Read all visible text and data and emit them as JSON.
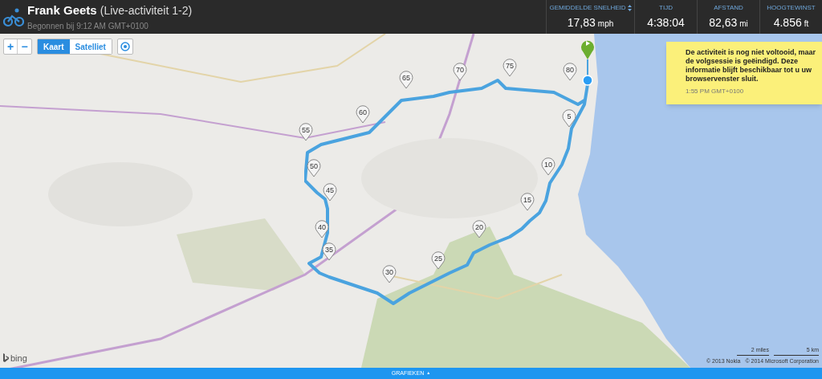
{
  "header": {
    "athlete": "Frank Geets",
    "activity": "(Live-activiteit 1-2)",
    "started": "Begonnen bij 9:12 AM GMT+0100"
  },
  "stats": [
    {
      "label": "GEMIDDELDE SNELHEID",
      "sortable": true,
      "value": "17,83",
      "unit": "mph"
    },
    {
      "label": "TIJD",
      "sortable": false,
      "value": "4:38:04"
    },
    {
      "label": "AFSTAND",
      "sortable": false,
      "value": "82,63",
      "unit": "mi"
    },
    {
      "label": "HOOGTEWINST",
      "sortable": false,
      "value": "4.856",
      "unit": "ft"
    }
  ],
  "map_controls": {
    "zoom_in": "+",
    "zoom_out": "−",
    "view_tabs": [
      {
        "label": "Kaart",
        "selected": true
      },
      {
        "label": "Satelliet",
        "selected": false
      }
    ]
  },
  "route": {
    "markers": [
      "5",
      "10",
      "15",
      "20",
      "25",
      "30",
      "35",
      "40",
      "45",
      "50",
      "55",
      "60",
      "65",
      "70",
      "75",
      "80"
    ]
  },
  "notice": {
    "text": "De activiteit is nog niet voltooid, maar de volgsessie is geëindigd. Deze informatie blijft beschikbaar tot u uw browservenster sluit.",
    "time": "1:55 PM GMT+0100"
  },
  "map_footer": {
    "logo": "bing",
    "scale": [
      "2 miles",
      "5 km"
    ],
    "copyright": [
      "© 2013 Nokia",
      "© 2014 Microsoft Corporation"
    ]
  },
  "charts_bar": {
    "label": "GRAFIEKEN",
    "caret": "▲"
  }
}
